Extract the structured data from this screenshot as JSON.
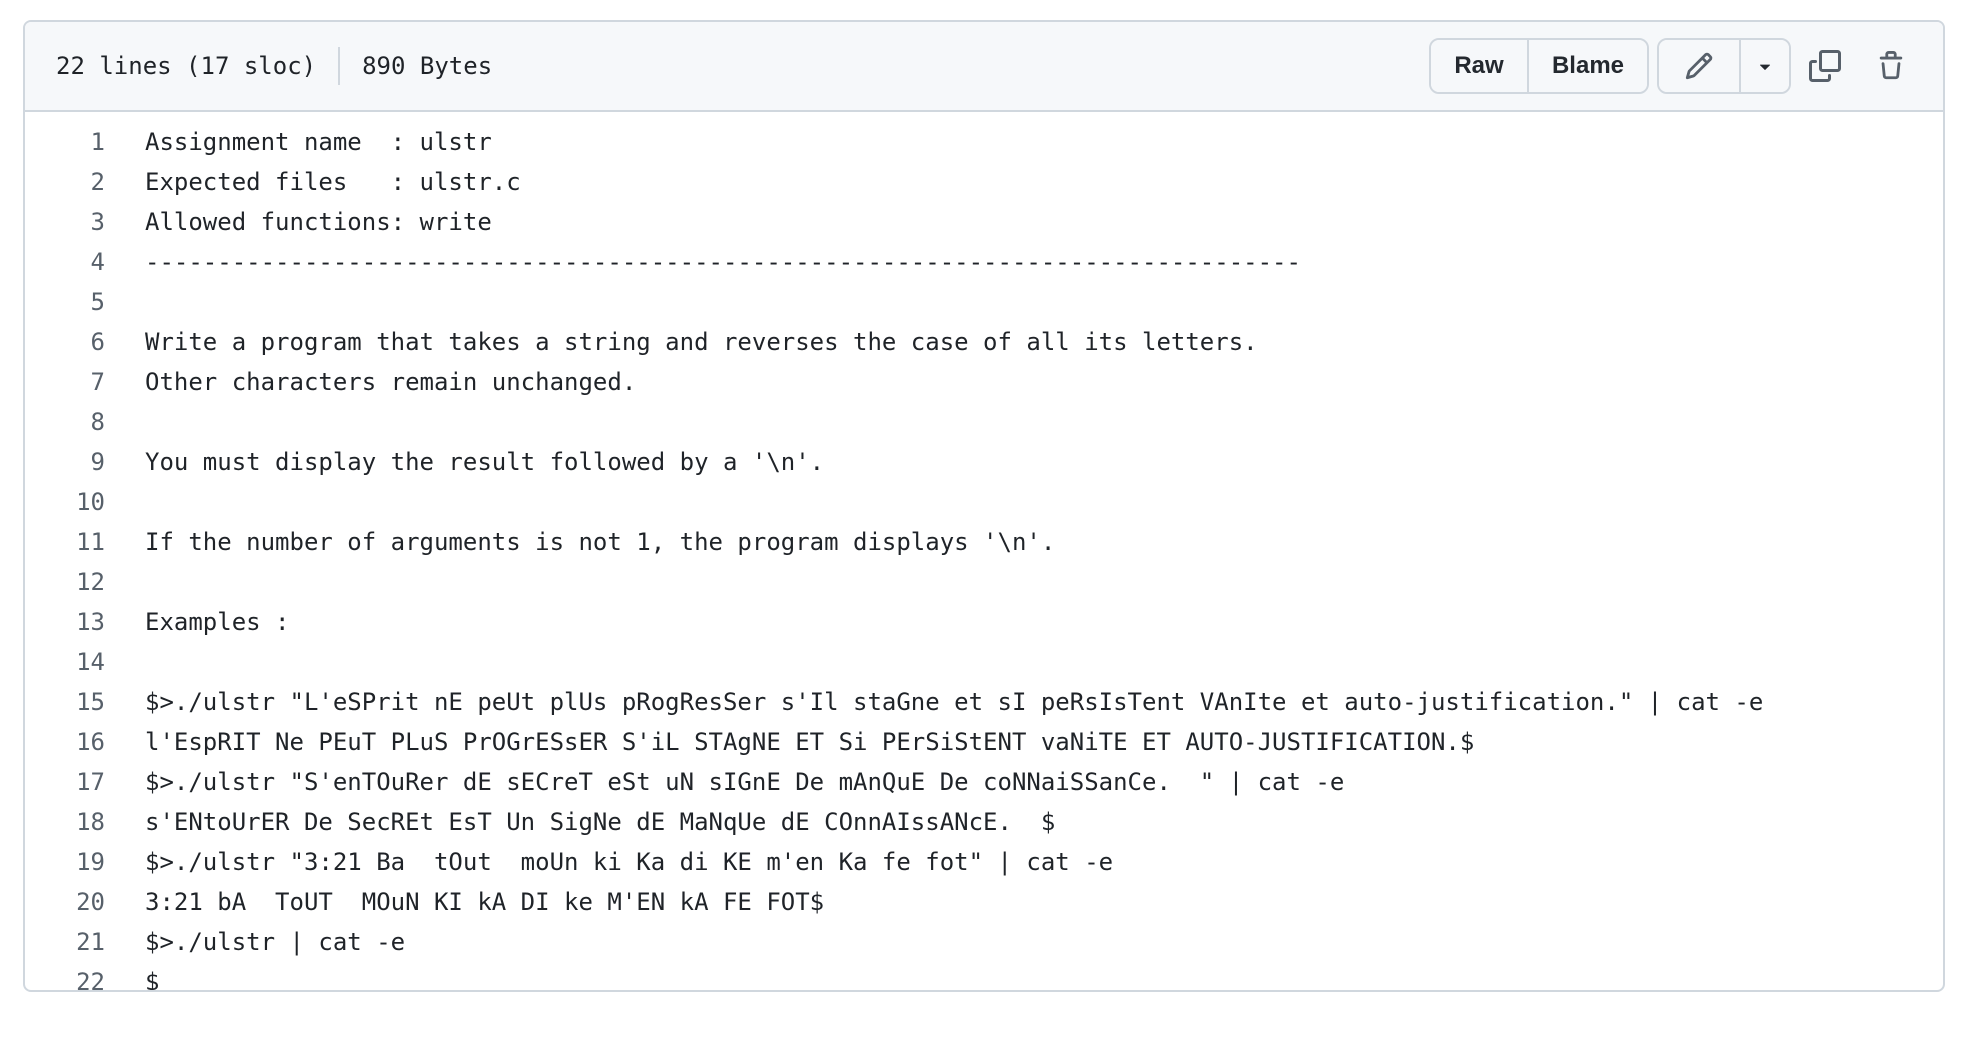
{
  "header": {
    "lines_info": "22 lines (17 sloc)",
    "size_info": "890 Bytes",
    "raw_label": "Raw",
    "blame_label": "Blame",
    "icons": {
      "edit": "pencil-icon",
      "more": "triangle-down-icon",
      "copy": "copy-icon",
      "delete": "trash-icon"
    }
  },
  "colors": {
    "border": "#d0d7de",
    "header_bg": "#f6f8fa",
    "text": "#1f2328",
    "line_number": "#57606a",
    "icon": "#57606a"
  },
  "code_lines": [
    {
      "n": "1",
      "text": "Assignment name  : ulstr"
    },
    {
      "n": "2",
      "text": "Expected files   : ulstr.c"
    },
    {
      "n": "3",
      "text": "Allowed functions: write"
    },
    {
      "n": "4",
      "text": "--------------------------------------------------------------------------------"
    },
    {
      "n": "5",
      "text": ""
    },
    {
      "n": "6",
      "text": "Write a program that takes a string and reverses the case of all its letters."
    },
    {
      "n": "7",
      "text": "Other characters remain unchanged."
    },
    {
      "n": "8",
      "text": ""
    },
    {
      "n": "9",
      "text": "You must display the result followed by a '\\n'."
    },
    {
      "n": "10",
      "text": ""
    },
    {
      "n": "11",
      "text": "If the number of arguments is not 1, the program displays '\\n'."
    },
    {
      "n": "12",
      "text": ""
    },
    {
      "n": "13",
      "text": "Examples :"
    },
    {
      "n": "14",
      "text": ""
    },
    {
      "n": "15",
      "text": "$>./ulstr \"L'eSPrit nE peUt plUs pRogResSer s'Il staGne et sI peRsIsTent VAnIte et auto-justification.\" | cat -e"
    },
    {
      "n": "16",
      "text": "l'EspRIT Ne PEuT PLuS PrOGrESsER S'iL STAgNE ET Si PErSiStENT vaNiTE ET AUTO-JUSTIFICATION.$"
    },
    {
      "n": "17",
      "text": "$>./ulstr \"S'enTOuRer dE sECreT eSt uN sIGnE De mAnQuE De coNNaiSSanCe.  \" | cat -e"
    },
    {
      "n": "18",
      "text": "s'ENtoUrER De SecREt EsT Un SigNe dE MaNqUe dE COnnAIssANcE.  $"
    },
    {
      "n": "19",
      "text": "$>./ulstr \"3:21 Ba  tOut  moUn ki Ka di KE m'en Ka fe fot\" | cat -e"
    },
    {
      "n": "20",
      "text": "3:21 bA  ToUT  MOuN KI kA DI ke M'EN kA FE FOT$"
    },
    {
      "n": "21",
      "text": "$>./ulstr | cat -e"
    },
    {
      "n": "22",
      "text": "$"
    }
  ]
}
